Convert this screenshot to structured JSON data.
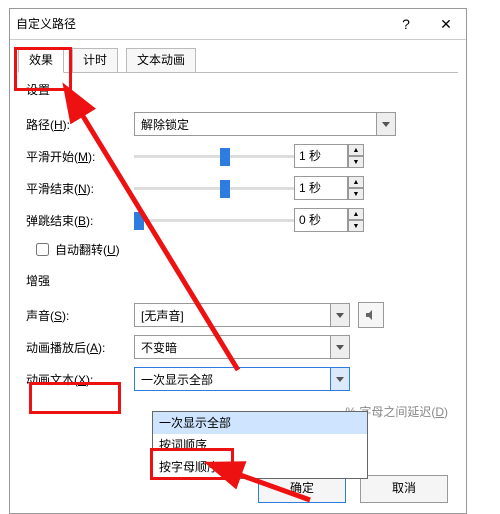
{
  "title": "自定义路径",
  "help": "?",
  "close": "✕",
  "tabs": {
    "effect": "效果",
    "timing": "计时",
    "textanim": "文本动画"
  },
  "settings": {
    "header": "设置",
    "path_label_a": "路径(",
    "path_label_u": "H",
    "path_label_b": "):",
    "path_value": "解除锁定",
    "smoothstart_a": "平滑开始(",
    "smoothstart_u": "M",
    "smoothstart_b": "):",
    "smoothend_a": "平滑结束(",
    "smoothend_u": "N",
    "smoothend_b": "):",
    "bounce_a": "弹跳结束(",
    "bounce_u": "B",
    "bounce_b": "):",
    "one_sec": "1 秒",
    "zero_sec": "0 秒",
    "autorev_a": "自动翻转(",
    "autorev_u": "U",
    "autorev_b": ")"
  },
  "enhance": {
    "header": "增强",
    "sound_a": "声音(",
    "sound_u": "S",
    "sound_b": "):",
    "sound_value": "[无声音]",
    "after_a": "动画播放后(",
    "after_u": "A",
    "after_b": "):",
    "after_value": "不变暗",
    "text_a": "动画文本(",
    "text_u": "X",
    "text_b": "):",
    "text_value": "一次显示全部",
    "opts": [
      "一次显示全部",
      "按词顺序",
      "按字母顺序"
    ],
    "delay_a": "字母之间延迟(",
    "delay_u": "D",
    "delay_b": ")"
  },
  "btn_ok": "确定",
  "btn_cancel": "取消"
}
